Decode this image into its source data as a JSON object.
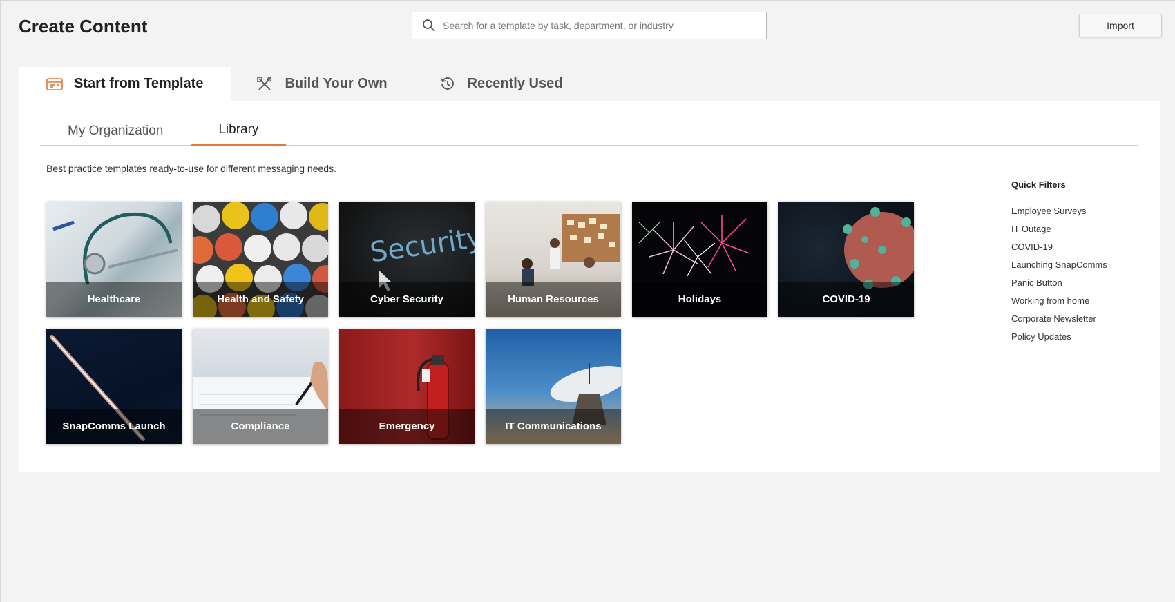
{
  "header": {
    "title": "Create Content",
    "search_placeholder": "Search for a template by task, department, or industry",
    "import_label": "Import"
  },
  "main_tabs": [
    {
      "label": "Start from Template",
      "icon": "template-icon",
      "active": true
    },
    {
      "label": "Build Your Own",
      "icon": "tools-icon",
      "active": false
    },
    {
      "label": "Recently Used",
      "icon": "history-icon",
      "active": false
    }
  ],
  "sub_tabs": [
    {
      "label": "My Organization",
      "active": false
    },
    {
      "label": "Library",
      "active": true
    }
  ],
  "description": "Best practice templates ready-to-use for different messaging needs.",
  "templates": [
    {
      "label": "Healthcare"
    },
    {
      "label": "Health and Safety"
    },
    {
      "label": "Cyber Security"
    },
    {
      "label": "Human Resources"
    },
    {
      "label": "Holidays"
    },
    {
      "label": "COVID-19"
    },
    {
      "label": "SnapComms Launch"
    },
    {
      "label": "Compliance"
    },
    {
      "label": "Emergency"
    },
    {
      "label": "IT Communications"
    }
  ],
  "quick_filters": {
    "title": "Quick Filters",
    "items": [
      "Employee Surveys",
      "IT Outage",
      "COVID-19",
      "Launching SnapComms",
      "Panic Button",
      "Working from home",
      "Corporate Newsletter",
      "Policy Updates"
    ]
  },
  "colors": {
    "accent": "#e07b39",
    "page_bg": "#f3f3f3",
    "panel_bg": "#ffffff"
  }
}
